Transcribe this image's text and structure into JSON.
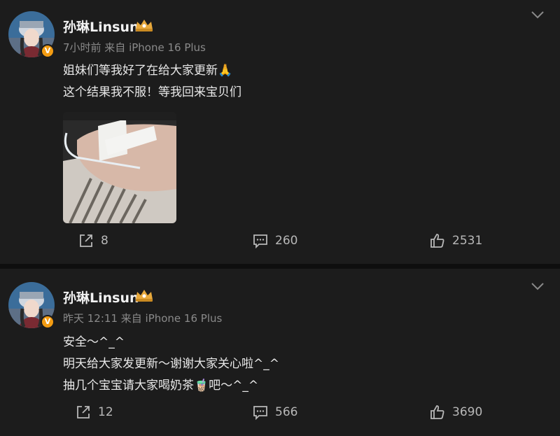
{
  "posts": [
    {
      "username": "孙琳Linsun",
      "meta": "7小时前  来自 iPhone 16 Plus",
      "lines": [
        "姐妹们等我好了在给大家更新🙏",
        " 这个结果我不服！等我回来宝贝们"
      ],
      "actions": {
        "share": "8",
        "comment": "260",
        "like": "2531"
      }
    },
    {
      "username": "孙琳Linsun",
      "meta": "昨天 12:11  来自 iPhone 16 Plus",
      "lines": [
        "安全～^_^",
        "明天给大家发更新～谢谢大家关心啦^_^",
        "抽几个宝宝请大家喝奶茶🧋吧～^_^"
      ],
      "actions": {
        "share": "12",
        "comment": "566",
        "like": "3690"
      }
    }
  ],
  "icons": {
    "share": "share-icon",
    "comment": "comment-icon",
    "like": "thumbs-up-icon",
    "verified": "verified-badge-icon",
    "crown": "crown-icon",
    "more": "chevron-down-icon"
  },
  "colors": {
    "background": "#1c1c1c",
    "verified": "#f39c12",
    "crown": "#e8a93c"
  }
}
